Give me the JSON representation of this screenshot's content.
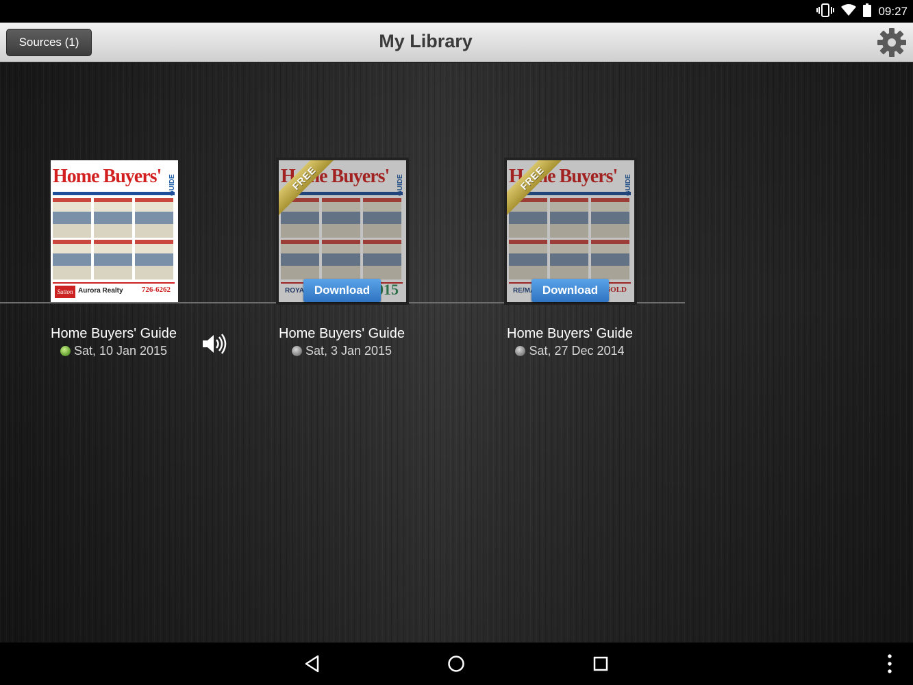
{
  "status_bar": {
    "time": "09:27",
    "icons": [
      "vibrate-icon",
      "wifi-icon",
      "battery-icon"
    ]
  },
  "header": {
    "sources_label": "Sources (1)",
    "title": "My Library",
    "settings_icon": "gear-icon"
  },
  "issues": [
    {
      "title": "Home Buyers' Guide",
      "date": "Sat, 10 Jan 2015",
      "status": "downloaded",
      "free_badge": "",
      "download_label": "",
      "cover": {
        "masthead": "Home Buyers'",
        "side_label": "GUIDE",
        "footer_brand": "Sutton",
        "footer_text": "Aurora Realty",
        "footer_phone": "726-6262"
      }
    },
    {
      "title": "Home Buyers' Guide",
      "date": "Sat, 3 Jan 2015",
      "status": "pending",
      "free_badge": "FREE",
      "download_label": "Download",
      "cover": {
        "masthead": "Home Buyers'",
        "side_label": "GUIDE",
        "footer_brand": "",
        "footer_text": "ROYAL LePAGE",
        "footer_phone": "2015"
      }
    },
    {
      "title": "Home Buyers' Guide",
      "date": "Sat, 27 Dec 2014",
      "status": "pending",
      "free_badge": "FREE",
      "download_label": "Download",
      "cover": {
        "masthead": "Home Buyers'",
        "side_label": "GUIDE",
        "footer_brand": "",
        "footer_text": "RE/MAX",
        "footer_phone": "SOLD"
      }
    }
  ],
  "audio_icon": "speaker-icon",
  "nav_bar": {
    "icons": [
      "back-icon",
      "home-icon",
      "recents-icon",
      "overflow-menu-icon"
    ]
  },
  "colors": {
    "download_button": "#3b85d6",
    "masthead_red": "#d21f1f",
    "header_text": "#3a3a3a"
  }
}
